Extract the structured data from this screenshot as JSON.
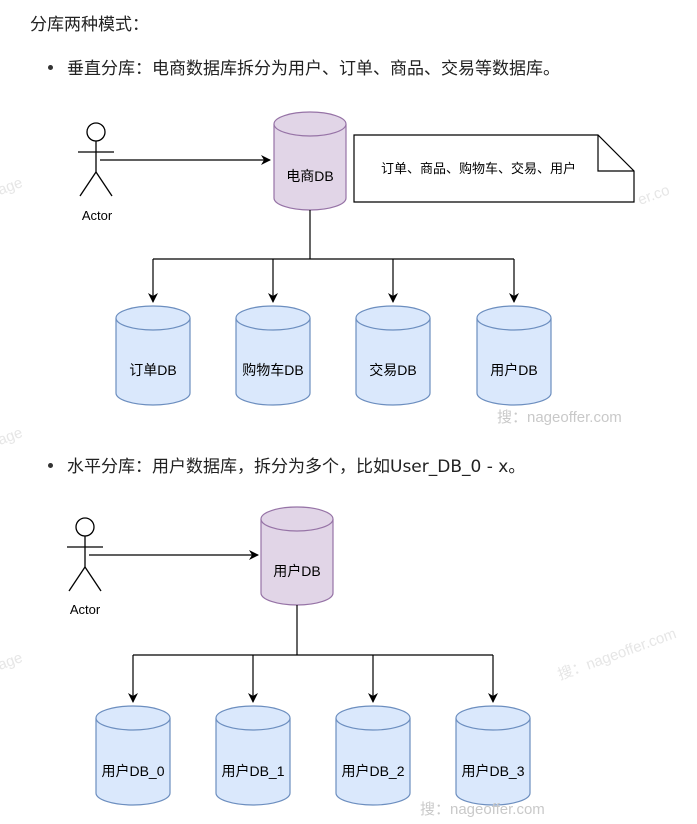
{
  "heading": "分库两种模式：",
  "bullets": {
    "vertical": "垂直分库：电商数据库拆分为用户、订单、商品、交易等数据库。",
    "horizontal": "水平分库：用户数据库，拆分为多个，比如User_DB_0 - x。"
  },
  "diagram1": {
    "actor": "Actor",
    "main_db": "电商DB",
    "note": "订单、商品、购物车、交易、用户",
    "children": [
      "订单DB",
      "购物车DB",
      "交易DB",
      "用户DB"
    ]
  },
  "diagram2": {
    "actor": "Actor",
    "main_db": "用户DB",
    "children": [
      "用户DB_0",
      "用户DB_1",
      "用户DB_2",
      "用户DB_3"
    ]
  },
  "watermarks": [
    "搜：nageoffer.com",
    "搜：nageoffer.com"
  ],
  "colors": {
    "main_db_fill": "#e1d5e7",
    "main_db_stroke": "#9673a6",
    "child_db_fill": "#dae8fc",
    "child_db_stroke": "#6c8ebf"
  }
}
